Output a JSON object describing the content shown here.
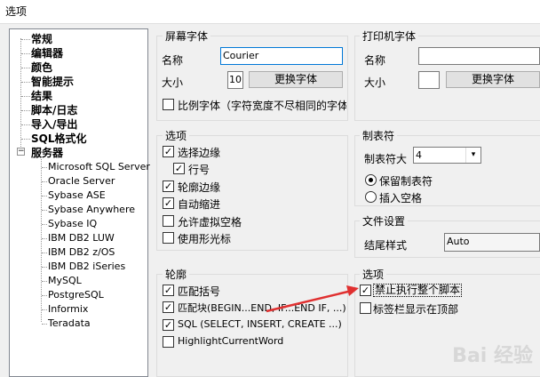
{
  "window": {
    "title": "选项"
  },
  "tree": {
    "top_items": [
      "常规",
      "编辑器",
      "颜色",
      "智能提示",
      "结果",
      "脚本/日志",
      "导入/导出",
      "SQL格式化",
      "服务器"
    ],
    "expander": "−",
    "server_items": [
      "Microsoft SQL Server",
      "Oracle Server",
      "Sybase ASE",
      "Sybase Anywhere",
      "Sybase IQ",
      "IBM DB2 LUW",
      "IBM DB2 z/OS",
      "IBM DB2 iSeries",
      "MySQL",
      "PostgreSQL",
      "Informix",
      "Teradata"
    ]
  },
  "screen_font": {
    "title": "屏幕字体",
    "name_label": "名称",
    "name_value": "Courier",
    "size_label": "大小",
    "size_value": "10",
    "change_button": "更换字体",
    "proportional_label": "比例字体（字符宽度不尽相同的字体",
    "proportional_checked": false
  },
  "printer_font": {
    "title": "打印机字体",
    "name_label": "名称",
    "name_value": "",
    "size_label": "大小",
    "size_value": "",
    "change_button": "更换字体"
  },
  "options": {
    "title": "选项",
    "items": [
      {
        "label": "选择边缘",
        "checked": true
      },
      {
        "label": "行号",
        "checked": true
      },
      {
        "label": "轮廓边缘",
        "checked": true
      },
      {
        "label": "自动缩进",
        "checked": true
      },
      {
        "label": "允许虚拟空格",
        "checked": false
      },
      {
        "label": "使用形光标",
        "checked": false
      }
    ]
  },
  "tabs": {
    "title": "制表符",
    "tab_label": "制表符大",
    "tab_value": "4",
    "dropdown_arrow": "▾",
    "keep_label": "保留制表符",
    "keep_selected": true,
    "insert_label": "插入空格",
    "insert_selected": false
  },
  "file_settings": {
    "title": "文件设置",
    "end_label": "结尾样式",
    "end_value": "Auto"
  },
  "outline": {
    "title": "轮廓",
    "items": [
      {
        "label": "匹配括号",
        "checked": true
      },
      {
        "label": "匹配块(BEGIN...END, IF...END IF, ...)",
        "checked": true
      },
      {
        "label": "SQL (SELECT, INSERT, CREATE ...)",
        "checked": true
      },
      {
        "label": "HighlightCurrentWord",
        "checked": false
      }
    ]
  },
  "options2": {
    "title": "选项",
    "items": [
      {
        "label": "禁止执行整个脚本",
        "checked": true
      },
      {
        "label": "标签栏显示在顶部",
        "checked": false
      }
    ]
  },
  "check_glyph": "✓",
  "watermark": "Bai 经验",
  "colors": {
    "annotation_arrow": "#e03030",
    "focus_border": "#0078d7"
  }
}
